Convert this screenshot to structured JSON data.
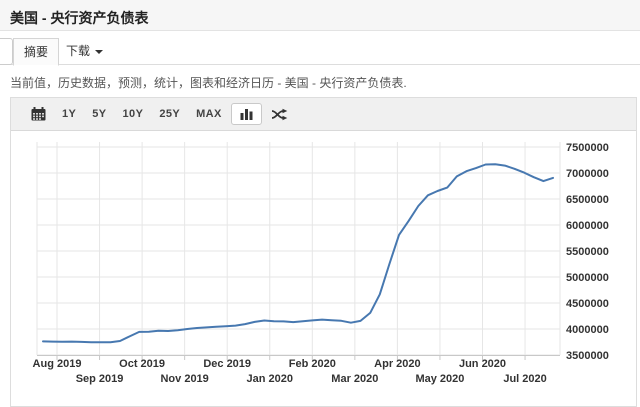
{
  "header": {
    "title": "美国 - 央行资产负债表"
  },
  "tabs": [
    {
      "label": "摘要",
      "active": true
    },
    {
      "label": "下载",
      "active": false,
      "caret": true
    }
  ],
  "description": {
    "text": "当前值，历史数据，预测，统计，图表和经济日历 - 美国 - 央行资产负债表."
  },
  "toolbar": {
    "range_buttons": [
      "1Y",
      "5Y",
      "10Y",
      "25Y",
      "MAX"
    ],
    "icons": {
      "calendar": "calendar-icon",
      "chart_type": "bar-chart-icon",
      "compare": "shuffle-icon"
    }
  },
  "chart_data": {
    "type": "line",
    "x_months": [
      "Aug 2019",
      "Sep 2019",
      "Oct 2019",
      "Nov 2019",
      "Dec 2019",
      "Jan 2020",
      "Feb 2020",
      "Mar 2020",
      "Apr 2020",
      "May 2020",
      "Jun 2020",
      "Jul 2020"
    ],
    "x_label_stagger": true,
    "y_ticks": [
      3500000,
      4000000,
      4500000,
      5000000,
      5500000,
      6000000,
      6500000,
      7000000,
      7500000
    ],
    "ylim": [
      3500000,
      7500000
    ],
    "y_axis_position": "right",
    "grid": true,
    "grid_color": "#e6e6e6",
    "axis_color": "#c8c8c8",
    "label_color": "#333333",
    "series": [
      {
        "name": "央行资产负债表",
        "color": "#4778b0",
        "interval": "weekly",
        "values": [
          3762000,
          3758000,
          3755000,
          3758000,
          3752000,
          3746000,
          3745000,
          3746000,
          3770000,
          3858000,
          3945000,
          3947000,
          3968000,
          3962000,
          3975000,
          4000000,
          4020000,
          4030000,
          4043000,
          4052000,
          4065000,
          4094000,
          4136000,
          4164000,
          4149000,
          4146000,
          4133000,
          4150000,
          4166000,
          4180000,
          4170000,
          4158000,
          4122000,
          4155000,
          4310000,
          4668000,
          5250000,
          5810000,
          6080000,
          6365000,
          6572000,
          6654000,
          6720000,
          6935000,
          7035000,
          7095000,
          7163000,
          7168000,
          7142000,
          7080000,
          7008000,
          6920000,
          6845000,
          6905000
        ]
      }
    ]
  }
}
